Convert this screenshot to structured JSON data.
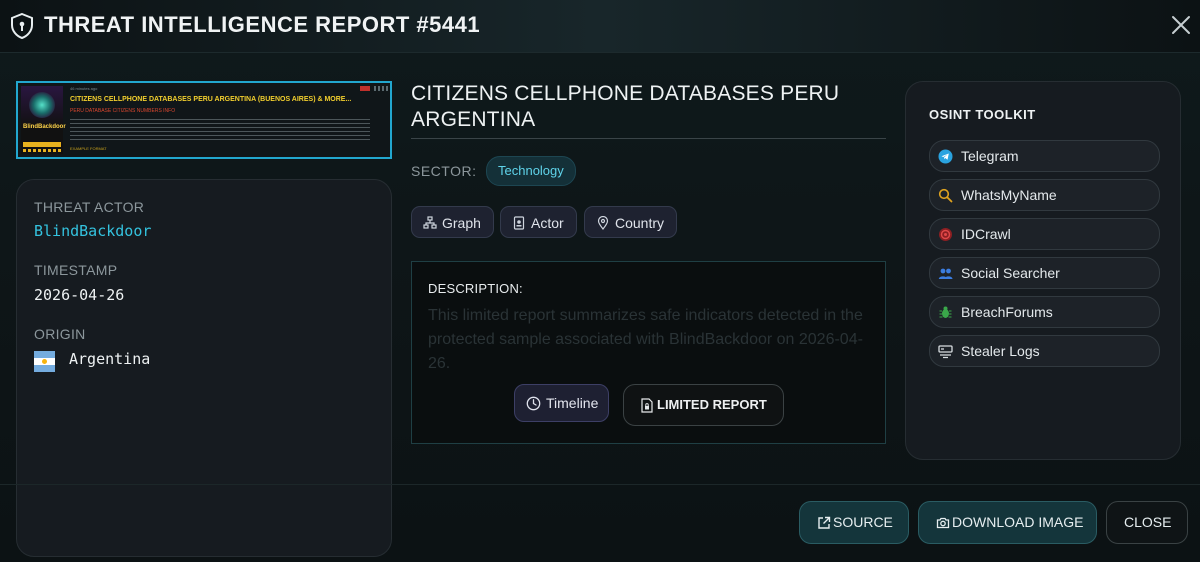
{
  "header": {
    "title": "THREAT INTELLIGENCE REPORT #5441"
  },
  "thumbnail": {
    "meta": "46 minutes ago",
    "avatar_name": "BlindBackdoor",
    "headline": "CITIZENS CELLPHONE DATABASES PERU ARGENTINA (BUENOS AIRES) & MORE...",
    "subline": "PERU DATABASE CITIZENS NUMBERS INFO",
    "footer": "EXAMPLE FORMAT"
  },
  "info": {
    "actor_label": "THREAT ACTOR",
    "actor_value": "BlindBackdoor",
    "timestamp_label": "TIMESTAMP",
    "timestamp_value": "2026-04-26",
    "origin_label": "ORIGIN",
    "origin_value": "Argentina"
  },
  "report": {
    "title": "CITIZENS CELLPHONE DATABASES PERU ARGENTINA",
    "sector_label": "SECTOR:",
    "sector_value": "Technology",
    "chips": [
      "Graph",
      "Actor",
      "Country"
    ],
    "description_label": "DESCRIPTION:",
    "description_text": "This limited report summarizes safe indicators detected in the protected sample associated with BlindBackdoor on 2026-04-26.",
    "timeline_label": "Timeline",
    "limited_label": "LIMITED REPORT"
  },
  "osint": {
    "title": "OSINT TOOLKIT",
    "tools": [
      {
        "label": "Telegram",
        "icon": "telegram-icon",
        "color": "#2aa3e0"
      },
      {
        "label": "WhatsMyName",
        "icon": "search-icon",
        "color": "#e0a31f"
      },
      {
        "label": "IDCrawl",
        "icon": "idcrawl-icon",
        "color": "#d23a3a"
      },
      {
        "label": "Social Searcher",
        "icon": "users-icon",
        "color": "#3b7de0"
      },
      {
        "label": "BreachForums",
        "icon": "bug-icon",
        "color": "#3aa84a"
      },
      {
        "label": "Stealer Logs",
        "icon": "terminal-icon",
        "color": "#d8dde0"
      }
    ]
  },
  "footer": {
    "source_label": "SOURCE",
    "download_label": "DOWNLOAD IMAGE",
    "close_label": "CLOSE"
  },
  "colors": {
    "accent": "#34c3df",
    "background": "#0d1416",
    "card": "#161b20"
  }
}
